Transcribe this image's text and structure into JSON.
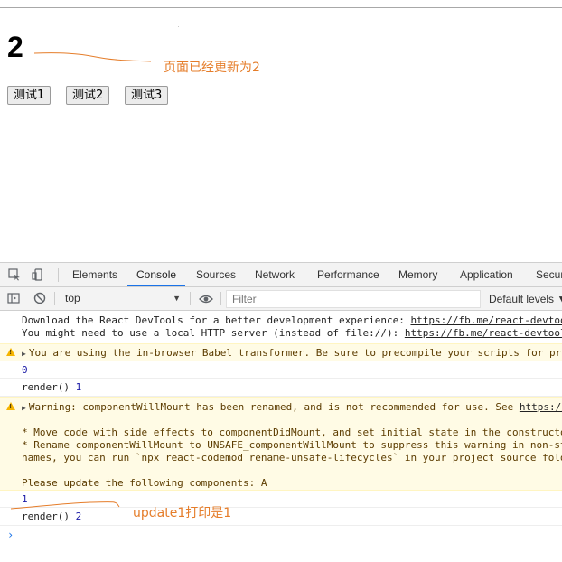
{
  "page": {
    "count_value": "2",
    "annotation_top": "页面已经更新为2",
    "buttons": [
      "测试1",
      "测试2",
      "测试3"
    ]
  },
  "devtools": {
    "tabs": [
      "Elements",
      "Console",
      "Sources",
      "Network",
      "Performance",
      "Memory",
      "Application",
      "Security"
    ],
    "active_tab": "Console",
    "context_select": "top",
    "filter_placeholder": "Filter",
    "levels_label": "Default levels ▼",
    "console": {
      "line1a": "Download the React DevTools for a better development experience: ",
      "line1a_link": "https://fb.me/react-devtools",
      "line1b": "You might need to use a local HTTP server (instead of file://): ",
      "line1b_link": "https://fb.me/react-devtools-faq",
      "warn1": "You are using the in-browser Babel transformer. Be sure to precompile your scripts for production",
      "log_zero": "0",
      "render1_label": "render() ",
      "render1_value": "1",
      "warn2_a": "Warning: componentWillMount has been renamed, and is not recommended for use. See ",
      "warn2_a_link": "https://fb.me/react-unsafe-component-lifecycles",
      "warn2_b": "* Move code with side effects to componentDidMount, and set initial state in the constructor.",
      "warn2_c": "* Rename componentWillMount to UNSAFE_componentWillMount to suppress this warning in non-strict mode. In React 17.x, only the UNSAFE_ name will work. To rename all deprecated lifecycles to their new",
      "warn2_d": "names, you can run `npx react-codemod rename-unsafe-lifecycles` in your project source folder.",
      "warn2_e": "Please update the following components: A",
      "log_one": "1",
      "render2_label": "render() ",
      "render2_value": "2",
      "prompt": "›"
    },
    "annotation_bottom": "update1打印是1"
  },
  "colors": {
    "annotation": "#e57d2a",
    "active_tab_underline": "#1a73e8",
    "warning_bg": "#fffbe5",
    "number": "#1a1aa6"
  }
}
